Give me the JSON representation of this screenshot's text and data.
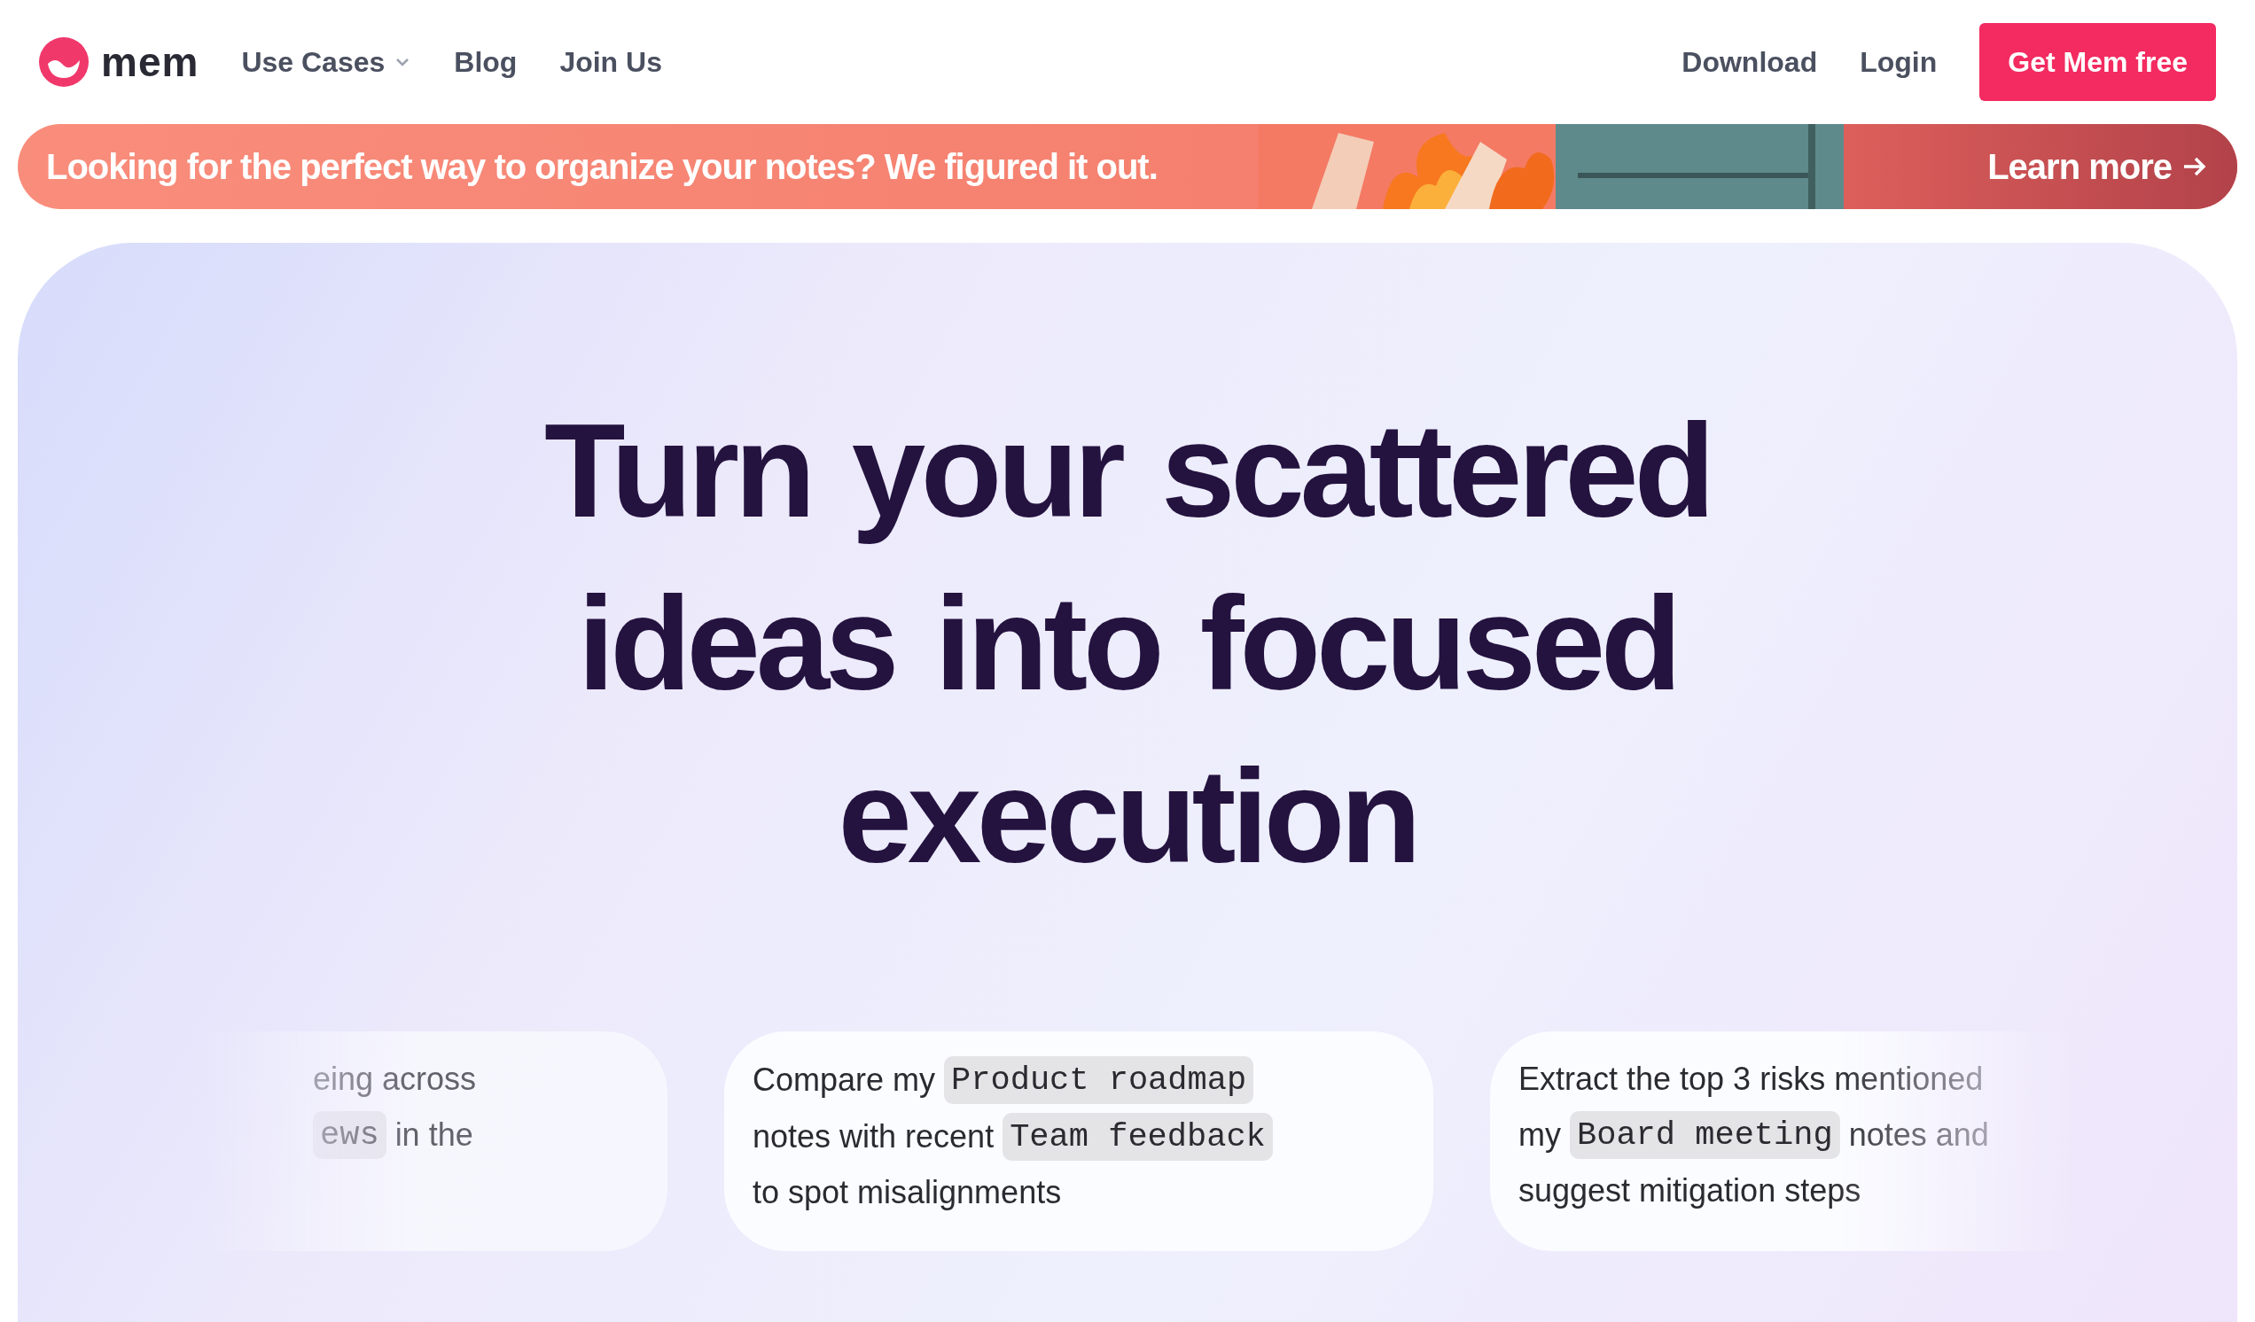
{
  "nav": {
    "logo_text": "mem",
    "links": [
      {
        "label": "Use Cases",
        "kind": "dropdown"
      },
      {
        "label": "Blog",
        "kind": "link"
      },
      {
        "label": "Join Us",
        "kind": "link"
      }
    ],
    "right_links": [
      "Download",
      "Login"
    ],
    "cta": "Get Mem free"
  },
  "banner": {
    "text": "Looking for the perfect way to organize your notes? We figured it out.",
    "action": "Learn more"
  },
  "hero": {
    "heading_lines": [
      "Turn your scattered",
      "ideas into focused",
      "execution"
    ]
  },
  "prompt_cards": [
    {
      "lines": [
        [
          {
            "kind": "text",
            "text": "eing across"
          }
        ],
        [
          {
            "kind": "code",
            "text": "ews"
          },
          {
            "kind": "text",
            "text": "in the"
          }
        ]
      ]
    },
    {
      "lines": [
        [
          {
            "kind": "text",
            "text": "Compare my"
          },
          {
            "kind": "code",
            "text": "Product roadmap"
          }
        ],
        [
          {
            "kind": "text",
            "text": "notes with recent"
          },
          {
            "kind": "code",
            "text": "Team feedback"
          }
        ],
        [
          {
            "kind": "text",
            "text": "to spot misalignments"
          }
        ]
      ]
    },
    {
      "lines": [
        [
          {
            "kind": "text",
            "text": "Extract the top 3 risks mentioned"
          }
        ],
        [
          {
            "kind": "text",
            "text": "my"
          },
          {
            "kind": "code",
            "text": "Board meeting"
          },
          {
            "kind": "text",
            "text": "notes and"
          }
        ],
        [
          {
            "kind": "text",
            "text": "suggest mitigation steps"
          }
        ]
      ]
    }
  ]
}
